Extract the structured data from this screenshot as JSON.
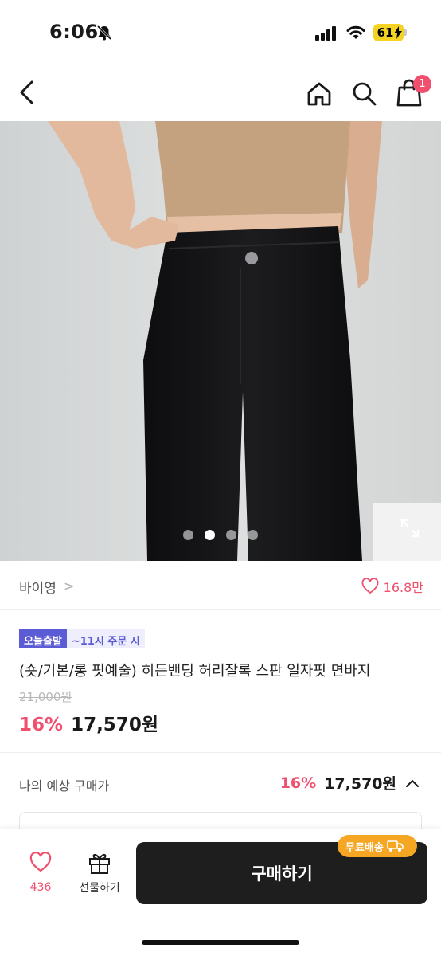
{
  "status_bar": {
    "time": "6:06",
    "battery": "61"
  },
  "nav": {
    "cart_count": "1"
  },
  "gallery": {
    "page_count": 4,
    "active_index": 1
  },
  "seller": {
    "name": "바이영",
    "chevron": ">",
    "likes": "16.8만"
  },
  "badges": {
    "today": "오늘출발",
    "cutoff": "~11시 주문 시"
  },
  "product": {
    "title": "(숏/기본/롱 핏예술) 히든밴딩 허리잘록 스판 일자핏 면바지",
    "original_price": "21,000원",
    "discount": "16%",
    "price": "17,570원"
  },
  "estimate": {
    "label": "나의 예상 구매가",
    "discount": "16%",
    "price": "17,570원"
  },
  "bottom": {
    "like_count": "436",
    "gift_label": "선물하기",
    "buy_label": "구매하기",
    "free_shipping": "무료배송"
  },
  "colors": {
    "accent": "#f0506e",
    "badge": "#5b5bd6",
    "buy_button": "#1e1e1e",
    "shipping": "#f5a623"
  }
}
